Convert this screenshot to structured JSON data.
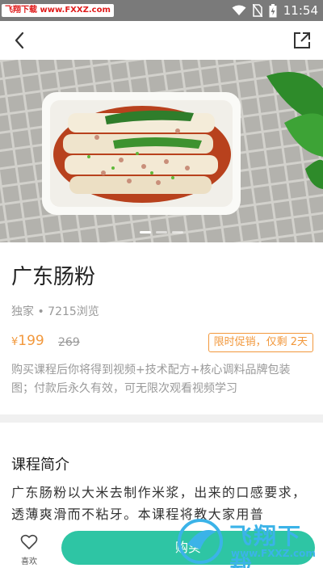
{
  "status_bar": {
    "watermark_badge": "飞翔下载 www.FXXZ.com",
    "time": "11:54",
    "icons": [
      "wifi-icon",
      "no-sim-icon",
      "battery-icon"
    ]
  },
  "nav": {
    "back_icon": "chevron-left-icon",
    "share_icon": "share-external-icon"
  },
  "course": {
    "title": "广东肠粉",
    "meta": "独家 • 7215浏览",
    "price_symbol": "¥",
    "price": "199",
    "original_price": "269",
    "promo": "限时促销，仅剩 2天",
    "description": "购买课程后你将得到视频+技术配方+核心调料品牌包装图；付款后永久有效，可无限次观看视频学习"
  },
  "carousel": {
    "count": 3,
    "active_index": 0
  },
  "intro": {
    "heading": "课程简介",
    "text": "广东肠粉以大米去制作米浆，出来的口感要求，透薄爽滑而不粘牙。本课程将教大家用普"
  },
  "bottom_bar": {
    "favorite_label": "喜欢",
    "buy_label": "购买"
  },
  "watermark": {
    "brand": "飞翔下载",
    "url": "www.FXXZ.com"
  },
  "colors": {
    "accent": "#2ec5a4",
    "price": "#f2983c",
    "status_bar": "#7a7a7a"
  }
}
